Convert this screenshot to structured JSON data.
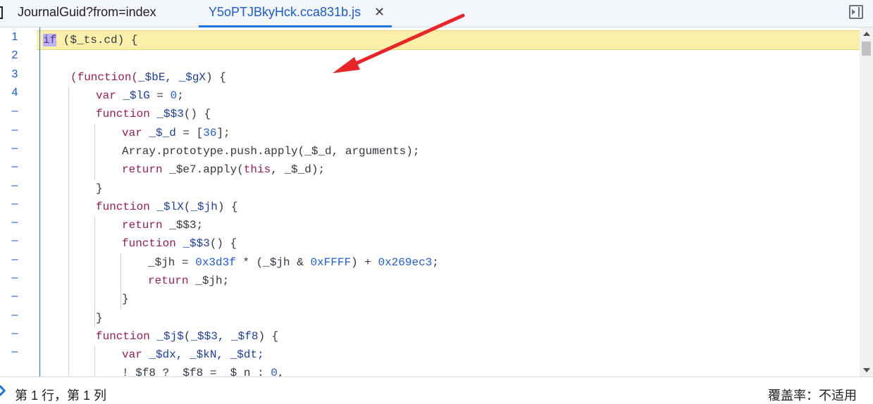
{
  "tabs": [
    {
      "label": "JournalGuid?from=index",
      "active": false
    },
    {
      "label": "Y5oPTJBkyHck.cca831b.js",
      "active": true,
      "close": "✕"
    }
  ],
  "gutter": [
    "1",
    "2",
    "3",
    "4",
    "–",
    "–",
    "–",
    "–",
    "–",
    "–",
    "–",
    "–",
    "–",
    "–",
    "–",
    "–",
    "–",
    "–"
  ],
  "code": {
    "l1_kw": "if",
    "l1_rest": " ($_ts.cd) {",
    "l3_a": "(function(",
    "l3_b": "_$bE, _$gX",
    "l3_c": ") {",
    "l4_kw": "var",
    "l4_id": " _$lG",
    "l4_eq": " = ",
    "l4_num": "0",
    "l4_end": ";",
    "l5_kw": "function",
    "l5_id": " _$$3",
    "l5_end": "() {",
    "l6_kw": "var",
    "l6_id": " _$_d",
    "l6_eq": " = [",
    "l6_num": "36",
    "l6_end": "];",
    "l7": "Array.prototype.push.apply(_$_d, arguments);",
    "l8_kw": "return",
    "l8_a": " _$e7.apply(",
    "l8_this": "this",
    "l8_b": ", _$_d);",
    "l9": "}",
    "l10_kw": "function",
    "l10_id": " _$lX",
    "l10_p": "(",
    "l10_arg": "_$jh",
    "l10_end": ") {",
    "l11_kw": "return",
    "l11_rest": " _$$3;",
    "l12_kw": "function",
    "l12_id": " _$$3",
    "l12_end": "() {",
    "l13_a": "_$jh = ",
    "l13_n1": "0x3d3f",
    "l13_b": " * (_$jh & ",
    "l13_n2": "0xFFFF",
    "l13_c": ") + ",
    "l13_n3": "0x269ec3",
    "l13_d": ";",
    "l14_kw": "return",
    "l14_rest": " _$jh;",
    "l15": "}",
    "l16": "}",
    "l17_kw": "function",
    "l17_id": " _$j$",
    "l17_p": "(",
    "l17_args": "_$$3, _$f8",
    "l17_end": ") {",
    "l18_kw": "var",
    "l18_rest": " _$dx, _$kN, _$dt;",
    "l19_a": "!_$f8 ? _$f8 = _$_n : ",
    "l19_num": "0",
    "l19_end": ","
  },
  "status": {
    "position": "第 1 行，第 1 列",
    "coverage": "覆盖率：不适用"
  },
  "colors": {
    "accent": "#1a73e8",
    "highlight": "#fbf0a9",
    "annotation_arrow": "#e8262a"
  }
}
